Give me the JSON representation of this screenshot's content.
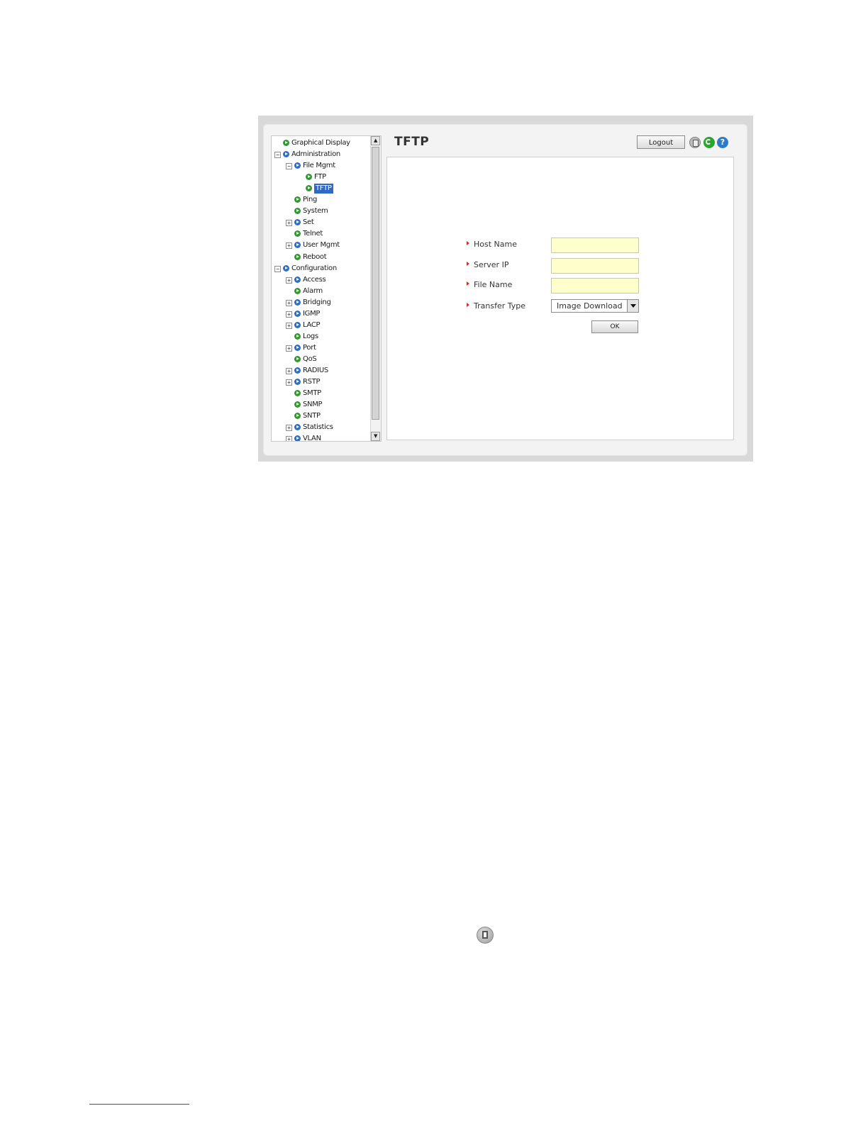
{
  "page": {
    "title": "TFTP",
    "logout_label": "Logout",
    "icons": [
      "save-icon",
      "refresh-icon",
      "help-icon"
    ],
    "help_glyph": "?"
  },
  "tree": {
    "items": [
      {
        "label": "Graphical Display",
        "level": 0,
        "expander": "",
        "icon": "green",
        "selected": false
      },
      {
        "label": "Administration",
        "level": 0,
        "expander": "-",
        "icon": "blue",
        "selected": false
      },
      {
        "label": "File Mgmt",
        "level": 1,
        "expander": "-",
        "icon": "blue",
        "selected": false
      },
      {
        "label": "FTP",
        "level": 2,
        "expander": "",
        "icon": "green",
        "selected": false
      },
      {
        "label": "TFTP",
        "level": 2,
        "expander": "",
        "icon": "green",
        "selected": true
      },
      {
        "label": "Ping",
        "level": 1,
        "expander": "",
        "icon": "green",
        "selected": false
      },
      {
        "label": "System",
        "level": 1,
        "expander": "",
        "icon": "green",
        "selected": false
      },
      {
        "label": "Set",
        "level": 1,
        "expander": "+",
        "icon": "blue",
        "selected": false
      },
      {
        "label": "Telnet",
        "level": 1,
        "expander": "",
        "icon": "green",
        "selected": false
      },
      {
        "label": "User Mgmt",
        "level": 1,
        "expander": "+",
        "icon": "blue",
        "selected": false
      },
      {
        "label": "Reboot",
        "level": 1,
        "expander": "",
        "icon": "green",
        "selected": false
      },
      {
        "label": "Configuration",
        "level": 0,
        "expander": "-",
        "icon": "blue",
        "selected": false
      },
      {
        "label": "Access",
        "level": 1,
        "expander": "+",
        "icon": "blue",
        "selected": false
      },
      {
        "label": "Alarm",
        "level": 1,
        "expander": "",
        "icon": "green",
        "selected": false
      },
      {
        "label": "Bridging",
        "level": 1,
        "expander": "+",
        "icon": "blue",
        "selected": false
      },
      {
        "label": "IGMP",
        "level": 1,
        "expander": "+",
        "icon": "blue",
        "selected": false
      },
      {
        "label": "LACP",
        "level": 1,
        "expander": "+",
        "icon": "blue",
        "selected": false
      },
      {
        "label": "Logs",
        "level": 1,
        "expander": "",
        "icon": "green",
        "selected": false
      },
      {
        "label": "Port",
        "level": 1,
        "expander": "+",
        "icon": "blue",
        "selected": false
      },
      {
        "label": "QoS",
        "level": 1,
        "expander": "",
        "icon": "green",
        "selected": false
      },
      {
        "label": "RADIUS",
        "level": 1,
        "expander": "+",
        "icon": "blue",
        "selected": false
      },
      {
        "label": "RSTP",
        "level": 1,
        "expander": "+",
        "icon": "blue",
        "selected": false
      },
      {
        "label": "SMTP",
        "level": 1,
        "expander": "",
        "icon": "green",
        "selected": false
      },
      {
        "label": "SNMP",
        "level": 1,
        "expander": "",
        "icon": "green",
        "selected": false
      },
      {
        "label": "SNTP",
        "level": 1,
        "expander": "",
        "icon": "green",
        "selected": false
      },
      {
        "label": "Statistics",
        "level": 1,
        "expander": "+",
        "icon": "blue",
        "selected": false
      },
      {
        "label": "VLAN",
        "level": 1,
        "expander": "+",
        "icon": "blue",
        "selected": false
      }
    ]
  },
  "form": {
    "host_name": {
      "label": "Host Name",
      "value": ""
    },
    "server_ip": {
      "label": "Server IP",
      "value": ""
    },
    "file_name": {
      "label": "File Name",
      "value": ""
    },
    "transfer_type": {
      "label": "Transfer Type",
      "value": "Image Download"
    },
    "ok_label": "OK"
  },
  "colors": {
    "input_bg": "#ffffcc",
    "selection": "#3168c6",
    "arrow": "#c0392b"
  }
}
